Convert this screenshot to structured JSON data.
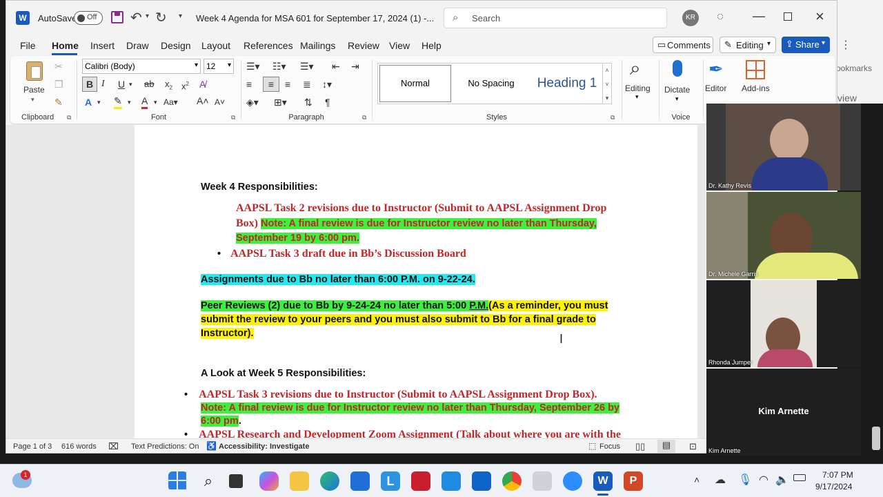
{
  "title": {
    "autosave_label": "AutoSave",
    "autosave_state": "Off",
    "doc_title": "Week 4 Agenda for MSA 601 for September 17, 2024 (1)  -...",
    "search_placeholder": "Search",
    "user_initials": "KR"
  },
  "menu": {
    "items": [
      "File",
      "Home",
      "Insert",
      "Draw",
      "Design",
      "Layout",
      "References",
      "Mailings",
      "Review",
      "View",
      "Help"
    ],
    "comments": "Comments",
    "editing": "Editing",
    "share": "Share"
  },
  "ribbon": {
    "clipboard": {
      "label": "Clipboard",
      "paste": "Paste"
    },
    "font": {
      "label": "Font",
      "name": "Calibri (Body)",
      "size": "12"
    },
    "paragraph": {
      "label": "Paragraph"
    },
    "styles": {
      "label": "Styles",
      "items": [
        "Normal",
        "No Spacing",
        "Heading 1"
      ]
    },
    "editing": "Editing",
    "dictate": "Dictate",
    "voice": "Voice",
    "editor": "Editor",
    "addins": "Add-ins",
    "editor_group_partial": "E"
  },
  "document": {
    "week4_heading": "Week 4 Responsibilities:",
    "task2_a": "AAPSL Task 2 revisions due to Instructor (Submit to AAPSL Assignment Drop",
    "task2_b": "Box) ",
    "task2_note1": "Note:  A final review is due for Instructor review no later than Thursday,",
    "task2_note2": "September 19 by 6:00 pm.",
    "task3_draft": "AAPSL Task 3 draft due in Bb’s Discussion Board",
    "assignments": "Assignments due to Bb no later than 6:00 P.M. on 9-22-24.",
    "peer_a": "Peer Reviews (2) due to Bb by 9-24-24 no later than 5:00 ",
    "peer_pm": "P.M.",
    "peer_b": "(As a reminder, you must",
    "peer_c": "submit the review to your peers and you must also submit to Bb for a final grade to",
    "peer_d": "Instructor).",
    "week5_heading": "A Look at Week 5 Responsibilities:",
    "task3_rev": "AAPSL Task 3 revisions due to Instructor (Submit to AAPSL Assignment Drop Box).",
    "task3_note1": "Note:  A final review is due for Instructor review no later than Thursday, September 26 by",
    "task3_note2": "6:00 pm",
    "task3_note2_end": ".",
    "research": "AAPSL Research and Development Zoom Assignment (Talk about where you are with the"
  },
  "status": {
    "page": "Page 1 of 3",
    "words": "616 words",
    "predictions": "Text Predictions: On",
    "accessibility": "Accessibility: Investigate",
    "focus": "Focus"
  },
  "background_window": {
    "text1": "ookmarks",
    "text2": "view"
  },
  "participants": [
    {
      "name": "Dr. Kathy Revis"
    },
    {
      "name": "Dr. Michele Garris"
    },
    {
      "name": "Rhonda Jumper"
    },
    {
      "name": "Kim Arnette"
    }
  ],
  "taskbar": {
    "weather_badge": "1",
    "time": "7:07 PM",
    "date": "9/17/2024"
  },
  "colors": {
    "accent": "#185abd",
    "highlight_green": "#3cf03c",
    "highlight_cyan": "#22e8f0",
    "highlight_yellow": "#fff200",
    "red_text": "#c0262a"
  }
}
